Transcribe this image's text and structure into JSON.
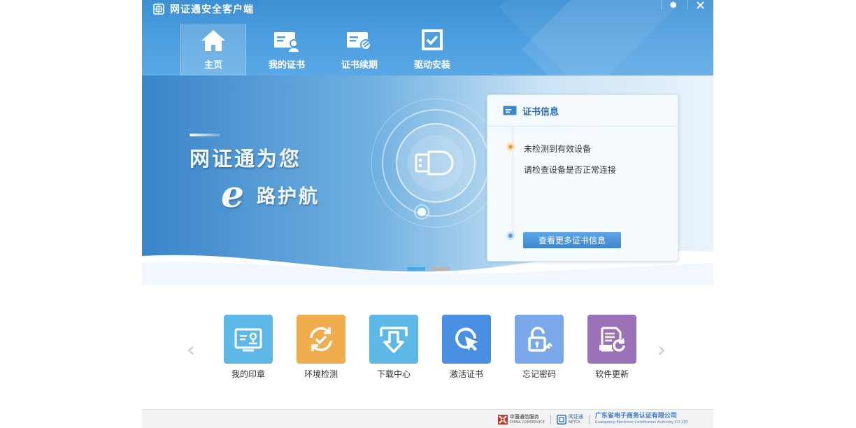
{
  "app": {
    "title": "网证通安全客户端"
  },
  "window_controls": {
    "settings_icon": "gear-icon",
    "close_icon": "close-icon"
  },
  "nav": {
    "tabs": [
      {
        "label": "主页",
        "icon": "home-icon",
        "active": true
      },
      {
        "label": "我的证书",
        "icon": "certificate-user-icon",
        "active": false
      },
      {
        "label": "证书续期",
        "icon": "certificate-renew-icon",
        "active": false
      },
      {
        "label": "驱动安装",
        "icon": "driver-install-icon",
        "active": false
      }
    ]
  },
  "banner": {
    "slogan_line1": "网证通为您",
    "slogan_e": "e",
    "slogan_line2": "路护航",
    "carousel": {
      "count": 2,
      "active_index": 0
    }
  },
  "cert_panel": {
    "title": "证书信息",
    "status_main": "未检测到有效设备",
    "status_sub": "请检查设备是否正常连接",
    "more_button": "查看更多证书信息"
  },
  "quick_actions": {
    "items": [
      {
        "label": "我的印章",
        "icon": "seal-icon",
        "color": "#5db8e8"
      },
      {
        "label": "环境检测",
        "icon": "refresh-check-icon",
        "color": "#f0ad4e"
      },
      {
        "label": "下载中心",
        "icon": "download-icon",
        "color": "#5db8e8"
      },
      {
        "label": "激活证书",
        "icon": "activate-cursor-icon",
        "color": "#4a90e2"
      },
      {
        "label": "忘记密码",
        "icon": "unlock-key-icon",
        "color": "#7aa8e8"
      },
      {
        "label": "软件更新",
        "icon": "software-update-icon",
        "color": "#9b72b8"
      }
    ]
  },
  "footer": {
    "logo1_text": "中国通信服务",
    "logo1_sub": "CHINA COMSERVICE",
    "logo2_text": "网证通",
    "logo2_sub": "NETCA",
    "company_name": "广东省电子商务认证有限公司",
    "company_sub": "Guangdong Electronic Certification Authority CO.,LTD"
  }
}
